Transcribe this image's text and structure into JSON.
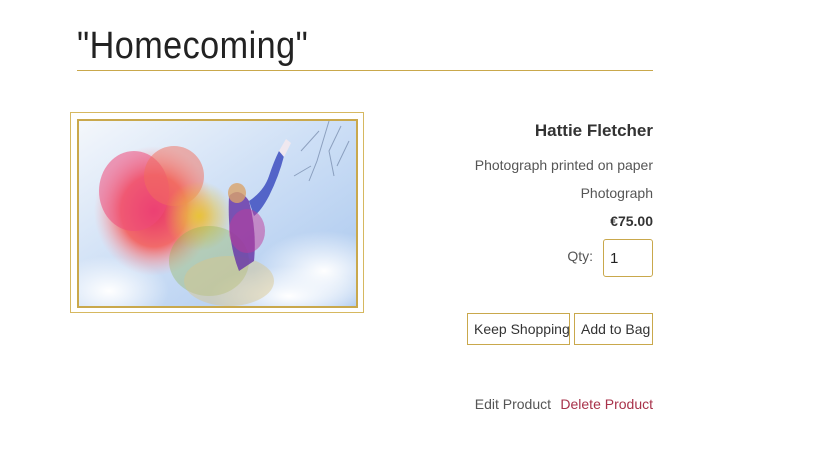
{
  "product": {
    "title": "\"Homecoming\"",
    "artist": "Hattie Fletcher",
    "medium": "Photograph printed on paper",
    "category": "Photograph",
    "price": "€75.00",
    "image_alt": "Homecoming photograph"
  },
  "quantity": {
    "label": "Qty:",
    "value": "1"
  },
  "actions": {
    "keep_shopping_label": "Keep Shopping",
    "add_to_bag_label": "Add to Bag",
    "edit_label": "Edit Product",
    "delete_label": "Delete Product"
  },
  "colors": {
    "accent_gold": "#c9a84c",
    "delete_red": "#a8324a",
    "text_dark": "#333333"
  }
}
